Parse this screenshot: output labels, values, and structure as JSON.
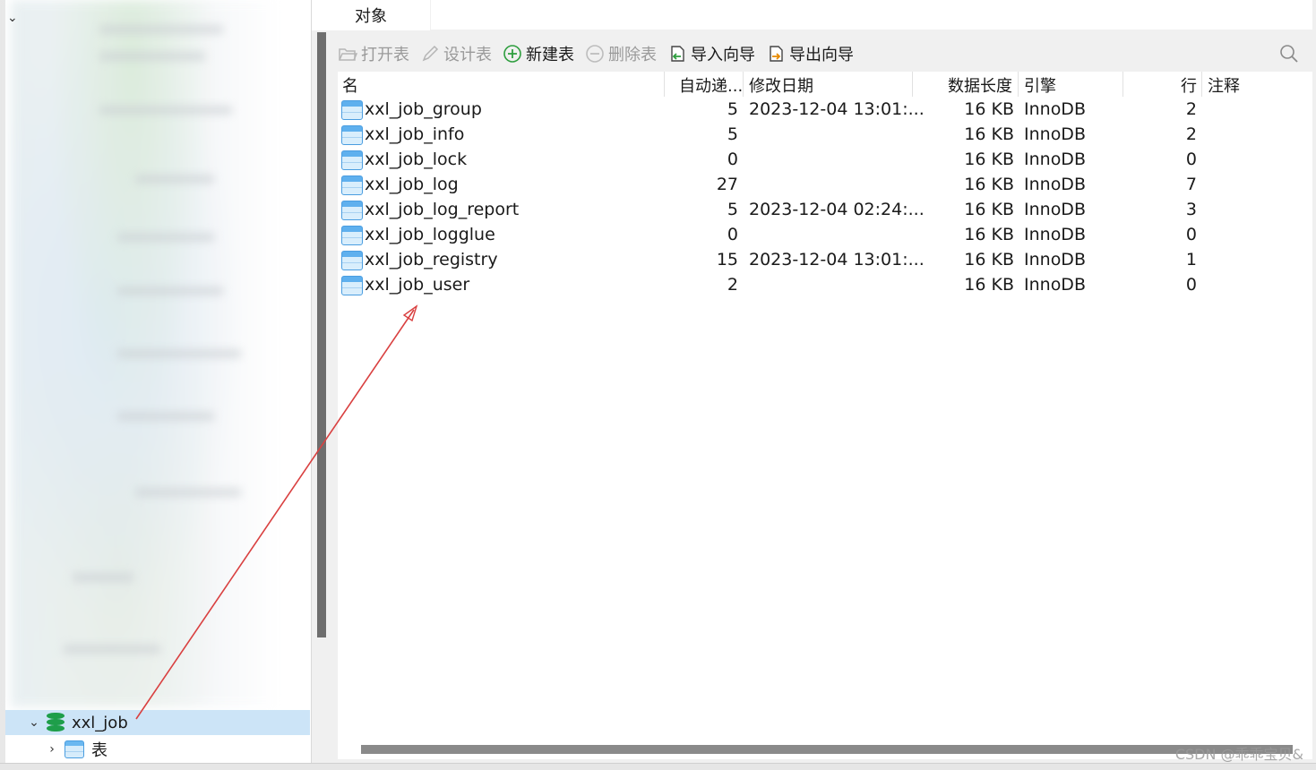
{
  "navigator": {
    "database_name": "xxl_job",
    "tables_node_label": "表"
  },
  "tab": {
    "label": "对象"
  },
  "toolbar": {
    "open_table": "打开表",
    "design_table": "设计表",
    "new_table": "新建表",
    "delete_table": "删除表",
    "import_wizard": "导入向导",
    "export_wizard": "导出向导"
  },
  "columns": {
    "name": "名",
    "auto_increment": "自动递...",
    "modified_date": "修改日期",
    "data_length": "数据长度",
    "engine": "引擎",
    "rows": "行",
    "comment": "注释"
  },
  "tables": [
    {
      "name": "xxl_job_group",
      "auto_inc": "5",
      "modified": "2023-12-04 13:01:...",
      "size": "16 KB",
      "engine": "InnoDB",
      "rows": "2",
      "comment": ""
    },
    {
      "name": "xxl_job_info",
      "auto_inc": "5",
      "modified": "",
      "size": "16 KB",
      "engine": "InnoDB",
      "rows": "2",
      "comment": ""
    },
    {
      "name": "xxl_job_lock",
      "auto_inc": "0",
      "modified": "",
      "size": "16 KB",
      "engine": "InnoDB",
      "rows": "0",
      "comment": ""
    },
    {
      "name": "xxl_job_log",
      "auto_inc": "27",
      "modified": "",
      "size": "16 KB",
      "engine": "InnoDB",
      "rows": "7",
      "comment": ""
    },
    {
      "name": "xxl_job_log_report",
      "auto_inc": "5",
      "modified": "2023-12-04 02:24:...",
      "size": "16 KB",
      "engine": "InnoDB",
      "rows": "3",
      "comment": ""
    },
    {
      "name": "xxl_job_logglue",
      "auto_inc": "0",
      "modified": "",
      "size": "16 KB",
      "engine": "InnoDB",
      "rows": "0",
      "comment": ""
    },
    {
      "name": "xxl_job_registry",
      "auto_inc": "15",
      "modified": "2023-12-04 13:01:...",
      "size": "16 KB",
      "engine": "InnoDB",
      "rows": "1",
      "comment": ""
    },
    {
      "name": "xxl_job_user",
      "auto_inc": "2",
      "modified": "",
      "size": "16 KB",
      "engine": "InnoDB",
      "rows": "0",
      "comment": ""
    }
  ],
  "watermark": "CSDN @乖乖宝贝&",
  "colors": {
    "selection": "#cce4f7",
    "db_icon": "#1e9e4a",
    "annotation_arrow": "#d94040"
  }
}
